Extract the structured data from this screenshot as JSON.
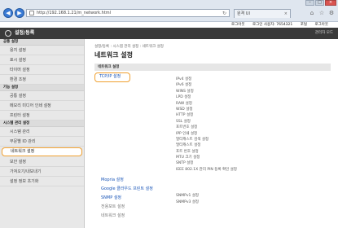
{
  "browser": {
    "url": "http://192.168.1.21/m_network.html",
    "tab_label": "원격 UI",
    "tab_close": "×",
    "nav": {
      "back": "◀",
      "forward": "▶",
      "refresh": "↻"
    },
    "window": {
      "min": "–",
      "max": "□",
      "close": "×"
    },
    "icons": [
      "home-icon",
      "star-icon",
      "gear-icon"
    ]
  },
  "header": {
    "user_items": [
      "로그아웃",
      "로그인 사용자: 7654321",
      "포털",
      "로그아웃"
    ],
    "title": "설정/등록",
    "mode_label": "관리자 모드"
  },
  "sidebar": {
    "sections": [
      {
        "heading": "공통 설정",
        "items": [
          "용지 설정",
          "표시 설정",
          "타이머 설정",
          "환경 조정"
        ]
      },
      {
        "heading": "기능 설정",
        "items": [
          "공통 설정",
          "메모리 미디어 인쇄 설정",
          "프린터 설정"
        ]
      },
      {
        "heading": "시스템 관리 설정",
        "items": [
          "시스템 관리",
          "부문별 ID 관리",
          "네트워크 설정",
          "보안 설정",
          "가져오기/내보내기",
          "설정 정보 초기화"
        ]
      }
    ],
    "selected": "네트워크 설정"
  },
  "main": {
    "breadcrumb": "설정/등록 : 시스템 관리 설정 : 네트워크 설정",
    "title": "네트워크 설정",
    "section_header": "네트워크 설정",
    "tcpip_link": "TCP/IP 설정",
    "tcpip_subitems": [
      "IPv4 설정",
      "IPv6 설정",
      "WINS 설정",
      "LPD 설정",
      "RAW 설정",
      "WSD 설정",
      "HTTP 설정",
      "SSL 설정",
      "포트번호 설정",
      "IPP 인쇄 설정",
      "멀티캐스트 검색 설정",
      "멀티캐스트 설정",
      "포트 번호 설정",
      "MTU 크기 설정",
      "SNTP 설정",
      "IEEE 802.1X 관리 PIN 등록 확인 설정"
    ],
    "links": [
      {
        "label": "Mopria 설정",
        "active": true
      },
      {
        "label": "Google 클라우드 프린트 설정",
        "active": true
      },
      {
        "label": "SNMP 설정",
        "active": true
      },
      {
        "label": "전용포트 설정",
        "active": false
      },
      {
        "label": "네트워크 설정",
        "active": false
      }
    ],
    "snmp_subitems": [
      "SNMPv1 설정",
      "SNMPv3 설정"
    ]
  }
}
